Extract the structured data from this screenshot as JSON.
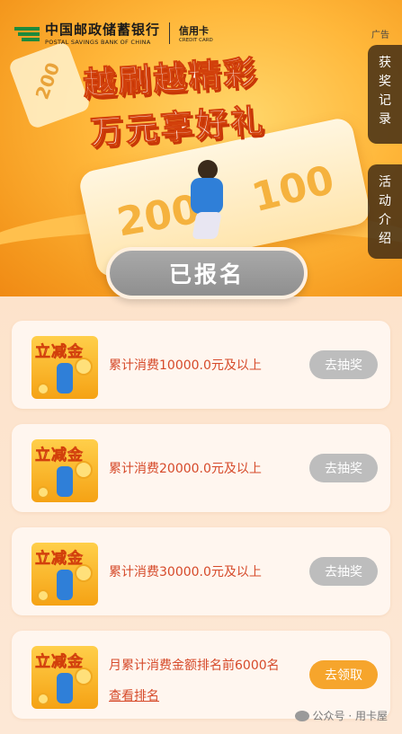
{
  "header": {
    "bank_cn": "中国邮政储蓄银行",
    "bank_en": "POSTAL SAVINGS BANK OF CHINA",
    "card_cn": "信用卡",
    "card_en": "CREDIT CARD",
    "ad_label": "广告"
  },
  "hero": {
    "slogan_line1": "越刷越精彩",
    "slogan_line2": "万元享好礼",
    "ticket_numbers": [
      "200",
      "100"
    ],
    "small_ticket_number": "200"
  },
  "side_buttons": [
    {
      "label": "获奖记录"
    },
    {
      "label": "活动介绍"
    }
  ],
  "status_button": {
    "label": "已报名"
  },
  "tasks": [
    {
      "thumb_title": "立减金",
      "description": "累计消费10000.0元及以上",
      "button": "去抽奖",
      "link": ""
    },
    {
      "thumb_title": "立减金",
      "description": "累计消费20000.0元及以上",
      "button": "去抽奖",
      "link": ""
    },
    {
      "thumb_title": "立减金",
      "description": "累计消费30000.0元及以上",
      "button": "去抽奖",
      "link": ""
    },
    {
      "thumb_title": "立减金",
      "description": "月累计消费金额排名前6000名",
      "button": "去领取",
      "link": "查看排名"
    }
  ],
  "watermark": "公众号 · 用卡屋",
  "colors": {
    "hero_orange": "#f59a1f",
    "accent_red": "#d64a2a",
    "disabled_button": "#bdbdbd",
    "active_button": "#f6a52c",
    "bank_green": "#1e8a3c"
  }
}
